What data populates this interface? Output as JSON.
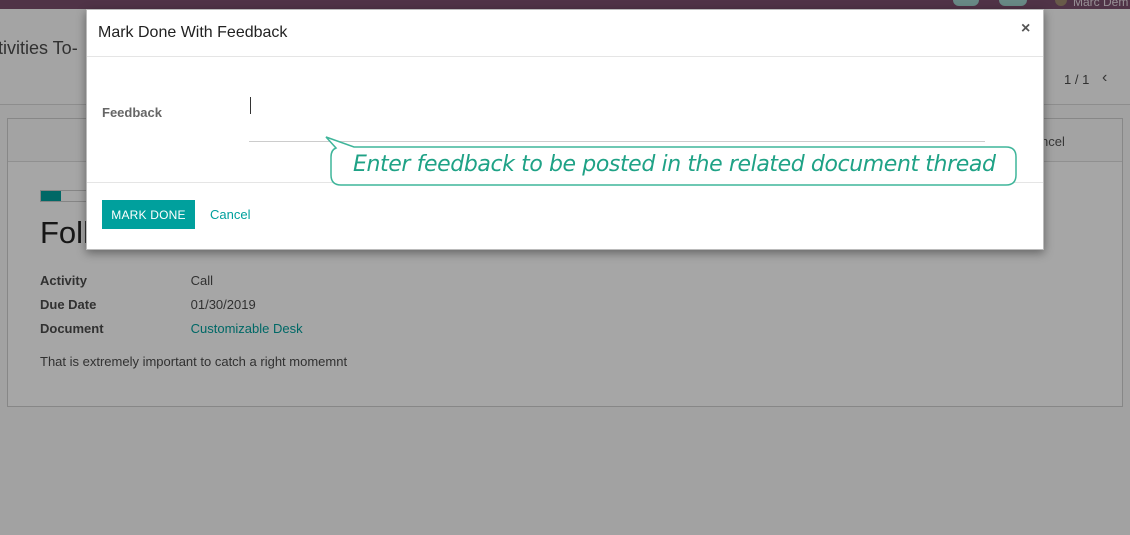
{
  "app": {
    "user_name": "Marc Dem",
    "breadcrumb": "tivities To-",
    "pager": "1 / 1",
    "pager_prev_icon": "chevron-left-icon"
  },
  "record": {
    "header_button": "ncel",
    "progress_percent": 25,
    "title": "Foll",
    "fields": [
      {
        "label": "Activity",
        "value": "Call"
      },
      {
        "label": "Due Date",
        "value": "01/30/2019"
      },
      {
        "label": "Document",
        "value": "Customizable Desk"
      }
    ],
    "note": "That is extremely important to catch a right momemnt"
  },
  "modal": {
    "title": "Mark Done With Feedback",
    "close_icon": "close-icon",
    "feedback_label": "Feedback",
    "feedback_value": "",
    "primary_button": "MARK DONE",
    "cancel_button": "Cancel"
  },
  "tooltip": {
    "text": "Enter feedback to be posted in the related document thread"
  },
  "colors": {
    "brand": "#7c4f6e",
    "accent": "#00a09d",
    "tooltip": "#1fa286"
  }
}
